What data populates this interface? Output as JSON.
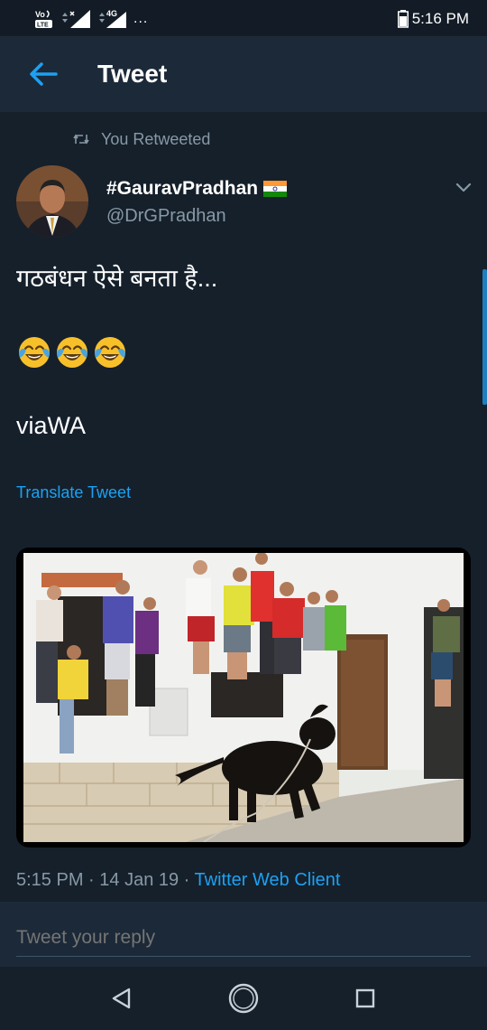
{
  "status_bar": {
    "volte_label": "VoLTE",
    "network_label": "4G",
    "more": "...",
    "time": "5:16 PM"
  },
  "header": {
    "title": "Tweet",
    "back_icon": "arrow-left-icon"
  },
  "retweet": {
    "label": "You Retweeted",
    "icon": "retweet-icon"
  },
  "author": {
    "name": "#GauravPradhan",
    "handle": "@DrGPradhan",
    "flag": "india-flag"
  },
  "tweet": {
    "line1": "गठबंधन ऐसे बनता है...",
    "emojis": [
      "face-with-tears-of-joy",
      "face-with-tears-of-joy",
      "face-with-tears-of-joy"
    ],
    "line2": "viaWA",
    "translate": "Translate Tweet"
  },
  "meta": {
    "time": "5:15 PM",
    "separator": " · ",
    "date": "14 Jan 19",
    "client": "Twitter Web Client"
  },
  "reply": {
    "placeholder": "Tweet your reply"
  },
  "colors": {
    "background": "#15202b",
    "header": "#1c2938",
    "accent": "#1da1f2",
    "secondary_text": "#8899a6"
  }
}
